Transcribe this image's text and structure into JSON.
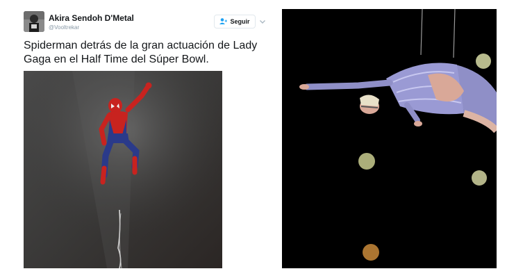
{
  "tweet": {
    "author_name": "Akira Sendoh D'Metal",
    "author_handle": "@Vooltrekar",
    "follow_label": "Seguir",
    "text": "Spiderman detrás de la gran actuación de Lady Gaga en el Half Time del Súper Bowl.",
    "icons": {
      "follow": "add-user-icon",
      "menu": "chevron-down-icon"
    }
  },
  "colors": {
    "follow_icon": "#1da1f2",
    "text": "#14171a",
    "handle": "#8899a6",
    "spiderman_red": "#c8231f",
    "spiderman_blue": "#2a3a8a",
    "costume_silver": "#8f8fc7"
  }
}
